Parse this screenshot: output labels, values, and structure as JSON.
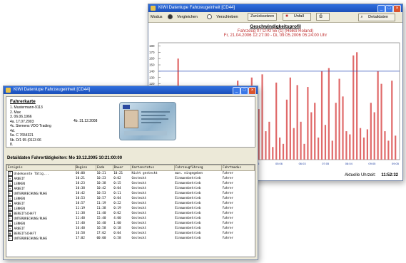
{
  "back_window": {
    "title": "KIWI Datenlupe Fahrzeugeinheit [CD44]",
    "toolbar": {
      "modus_label": "Modus",
      "vergleichen_label": "Vergleichen",
      "verschieben_label": "Verschieben",
      "zuruecksetzen_label": "Zurücksetzen",
      "unfall_label": "Unfall",
      "detaildaten_label": "Detaildaten"
    },
    "chart": {
      "title": "Geschwindigkeitsprofil",
      "subtitle_vehicle": "Fahrzeug 07    D-KI 55 (1) (Heiko Roland)",
      "subtitle_range": "Fr, 21.04.2006 12:27:00 - Di, 09.05.2006 05:24:00 Uhr",
      "y_ticks": [
        "180",
        "170",
        "160",
        "150",
        "140",
        "130",
        "120",
        "110",
        "100"
      ],
      "x_ticks": [
        "00:04",
        "01:06",
        "02:05",
        "03:04",
        "04:05",
        "05:06",
        "06:03",
        "07:05",
        "08:04",
        "09:05",
        "09:05"
      ],
      "status_label": "Aktuelle Uhrzeit:",
      "status_time": "11:52:32"
    }
  },
  "chart_data": {
    "type": "bar",
    "title": "Geschwindigkeitsprofil",
    "ylim": [
      0,
      185
    ],
    "reference_line": 140,
    "values": [
      28,
      12,
      30,
      45,
      22,
      160,
      35,
      18,
      25,
      60,
      40,
      15,
      30,
      22,
      55,
      30,
      20,
      25,
      18,
      40,
      90,
      30,
      125,
      45,
      20,
      60,
      130,
      25,
      80,
      135,
      45,
      60,
      20,
      122,
      35,
      25,
      95,
      130,
      50,
      118,
      60,
      25,
      115,
      75,
      90,
      35,
      140,
      55,
      145,
      30,
      90,
      128,
      100,
      45,
      40,
      165,
      170,
      50,
      35,
      48,
      90,
      75,
      140,
      120,
      45,
      30,
      125,
      38
    ]
  },
  "front_window": {
    "title": "KIWI Datenlupe Fahrzeugeinheit [CD44]",
    "card": {
      "heading": "Fahrerkarte",
      "lines": [
        "1.  Mustermann-9113",
        "2.  Max",
        "3.  06.06.1966",
        "4a. 17.07.2003",
        "4b. 31.12.2008",
        "4c. Siemens VDO Trading",
        "4d.",
        "5a. C 7654321",
        "5b. D/1 95 (0113 06",
        "8."
      ],
      "valid_label": "4b. 31.12.2008"
    },
    "detail_header": "Detaildaten Fahrertätigkeiten: Mo 19.12.2005 10:21:00:00",
    "table": {
      "columns": [
        "Ereignis",
        "Beginn",
        "Ende",
        "Dauer",
        "Kartenstatus",
        "Fahrzeugführung",
        "Fahrtmodus"
      ],
      "rows": [
        [
          "Unbekannte Tätig...",
          "00:00",
          "10:21",
          "10:21",
          "Nicht gesteckt",
          "man. eingegeben",
          "Fahrer"
        ],
        [
          "ARBEIT",
          "10:21",
          "10:23",
          "0:02",
          "Gesteckt",
          "Einmannbetrieb",
          "Fahrer"
        ],
        [
          "LENKEN",
          "10:23",
          "10:38",
          "0:15",
          "Gesteckt",
          "Einmannbetrieb",
          "Fahrer"
        ],
        [
          "ARBEIT",
          "10:38",
          "10:42",
          "0:04",
          "Gesteckt",
          "Einmannbetrieb",
          "Fahrer"
        ],
        [
          "UNTERBRECHUNG/RUHE",
          "10:42",
          "10:53",
          "0:11",
          "Gesteckt",
          "Einmannbetrieb",
          "Fahrer"
        ],
        [
          "LENKEN",
          "10:53",
          "10:57",
          "0:04",
          "Gesteckt",
          "Einmannbetrieb",
          "Fahrer"
        ],
        [
          "ARBEIT",
          "10:57",
          "11:19",
          "0:22",
          "Gesteckt",
          "Einmannbetrieb",
          "Fahrer"
        ],
        [
          "LENKEN",
          "11:19",
          "11:38",
          "0:19",
          "Gesteckt",
          "Einmannbetrieb",
          "Fahrer"
        ],
        [
          "BEREITSCHAFT",
          "11:38",
          "11:40",
          "0:02",
          "Gesteckt",
          "Einmannbetrieb",
          "Fahrer"
        ],
        [
          "UNTERBRECHUNG/RUHE",
          "11:40",
          "15:40",
          "4:00",
          "Gesteckt",
          "Einmannbetrieb",
          "Fahrer"
        ],
        [
          "LENKEN",
          "15:40",
          "16:40",
          "1:00",
          "Gesteckt",
          "Einmannbetrieb",
          "Fahrer"
        ],
        [
          "ARBEIT",
          "16:40",
          "16:58",
          "0:18",
          "Gesteckt",
          "Einmannbetrieb",
          "Fahrer"
        ],
        [
          "BEREITSCHAFT",
          "16:58",
          "17:02",
          "0:04",
          "Gesteckt",
          "Einmannbetrieb",
          "Fahrer"
        ],
        [
          "UNTERBRECHUNG/RUHE",
          "17:02",
          "00:00",
          "6:58",
          "Gesteckt",
          "Einmannbetrieb",
          "Fahrer"
        ]
      ]
    }
  }
}
